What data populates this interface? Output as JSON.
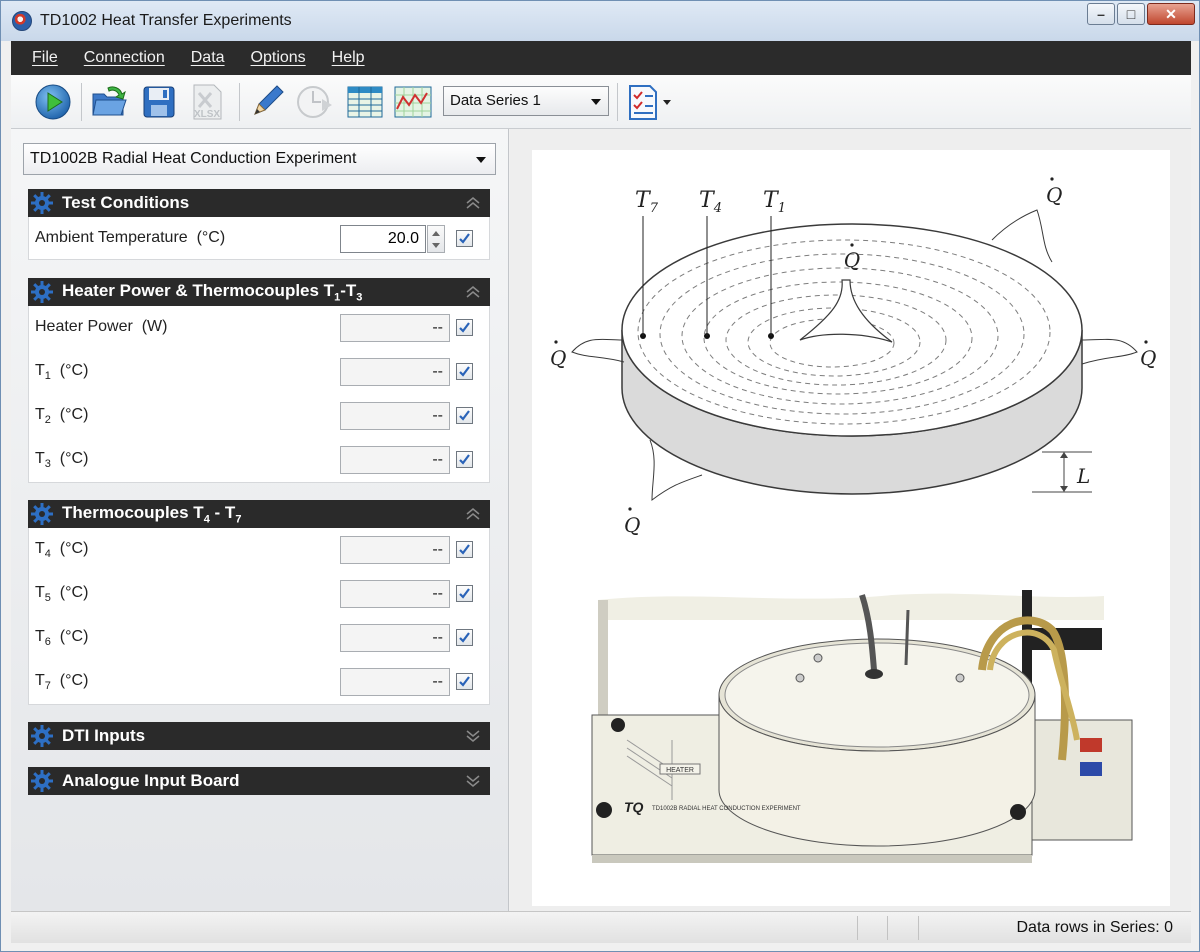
{
  "window": {
    "title": "TD1002 Heat Transfer Experiments",
    "controls": {
      "minimize": "–",
      "maximize": "□",
      "close": "✕"
    }
  },
  "menu": [
    "File",
    "Connection",
    "Data",
    "Options",
    "Help"
  ],
  "toolbar": {
    "icons": [
      "play-icon",
      "open-folder-icon",
      "save-disk-icon",
      "export-xlsx-icon",
      "pencil-icon",
      "clock-icon",
      "table-icon",
      "graph-icon",
      "checklist-icon"
    ],
    "xlsx_label": "XLSX",
    "series_select": "Data Series 1"
  },
  "experiment_select": "TD1002B Radial Heat Conduction Experiment",
  "sections": {
    "test_conditions": {
      "title": "Test Conditions",
      "ambient_label": "Ambient Temperature",
      "ambient_unit": "(°C)",
      "ambient_value": "20.0"
    },
    "heater": {
      "title_prefix": "Heater Power & Thermocouples T",
      "title_sub1": "1",
      "title_mid": "-T",
      "title_sub2": "3",
      "rows": [
        {
          "label": "Heater Power",
          "sub": "",
          "unit": "(W)",
          "value": "--"
        },
        {
          "label": "T",
          "sub": "1",
          "unit": "(°C)",
          "value": "--"
        },
        {
          "label": "T",
          "sub": "2",
          "unit": "(°C)",
          "value": "--"
        },
        {
          "label": "T",
          "sub": "3",
          "unit": "(°C)",
          "value": "--"
        }
      ]
    },
    "thermo47": {
      "title_prefix": "Thermocouples T",
      "title_sub1": "4",
      "title_mid": " - T",
      "title_sub2": "7",
      "rows": [
        {
          "label": "T",
          "sub": "4",
          "unit": "(°C)",
          "value": "--"
        },
        {
          "label": "T",
          "sub": "5",
          "unit": "(°C)",
          "value": "--"
        },
        {
          "label": "T",
          "sub": "6",
          "unit": "(°C)",
          "value": "--"
        },
        {
          "label": "T",
          "sub": "7",
          "unit": "(°C)",
          "value": "--"
        }
      ]
    },
    "dti": {
      "title": "DTI Inputs"
    },
    "analogue": {
      "title": "Analogue Input Board"
    }
  },
  "diagram": {
    "labels": {
      "t7": "T",
      "t7_sub": "7",
      "t4": "T",
      "t4_sub": "4",
      "t1": "T",
      "t1_sub": "1",
      "q": "Q",
      "l": "L"
    },
    "plate_text": "TD1002B RADIAL HEAT CONDUCTION EXPERIMENT",
    "heater_text": "HEATER"
  },
  "status": {
    "rows_text": "Data rows in Series: 0"
  },
  "colors": {
    "menubar": "#2b2b2b",
    "section_header": "#2a2a2a",
    "gear": "#2d6fc4",
    "check": "#2a63b8"
  }
}
